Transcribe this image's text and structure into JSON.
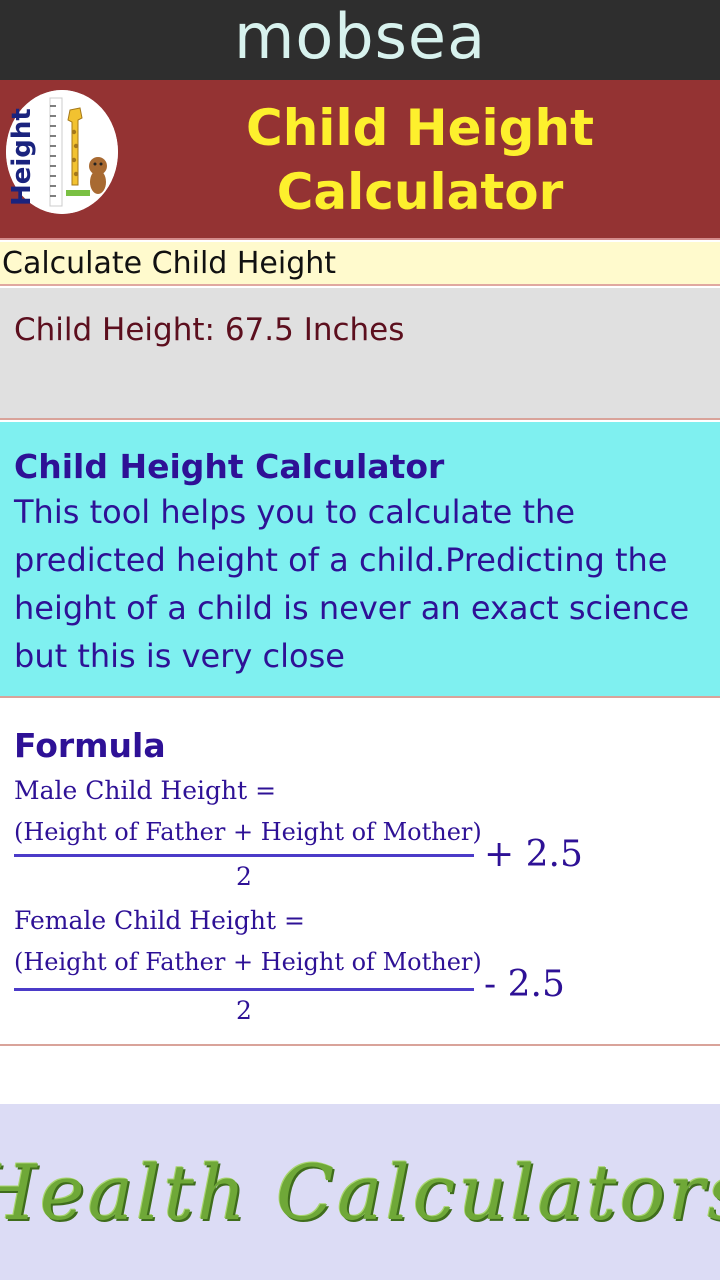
{
  "topbar": {
    "brand": "mobsea"
  },
  "header": {
    "title_line1": "Child Height",
    "title_line2": "Calculator",
    "logo_text": "Height",
    "logo_icon": "giraffe-height-chart-icon"
  },
  "subbar": {
    "label": "Calculate Child Height"
  },
  "result": {
    "text": "Child Height: 67.5 Inches"
  },
  "about": {
    "title": "Child Height Calculator",
    "body": "This tool helps you to calculate the predicted height of a child.Predicting the height of a child is never an exact science but this is very close"
  },
  "formula": {
    "title": "Formula",
    "male": {
      "label": "Male Child Height =",
      "numerator": "(Height of Father + Height of Mother)",
      "denominator": "2",
      "operator": "+ 2.5"
    },
    "female": {
      "label": "Female Child Height =",
      "numerator": "(Height of Father + Height of Mother)",
      "denominator": "2",
      "operator": "- 2.5"
    }
  },
  "footer": {
    "banner": "Health Calculators"
  },
  "colors": {
    "topbar_bg": "#2e2e2e",
    "header_bg": "#943333",
    "title_yellow": "#fdf02d",
    "subbar_bg": "#fffacd",
    "result_bg": "#e0e0e0",
    "about_bg": "#7ff0f0",
    "text_indigo": "#2e1196",
    "footer_bg": "#dcdcf5",
    "footer_green": "#6fa838"
  }
}
